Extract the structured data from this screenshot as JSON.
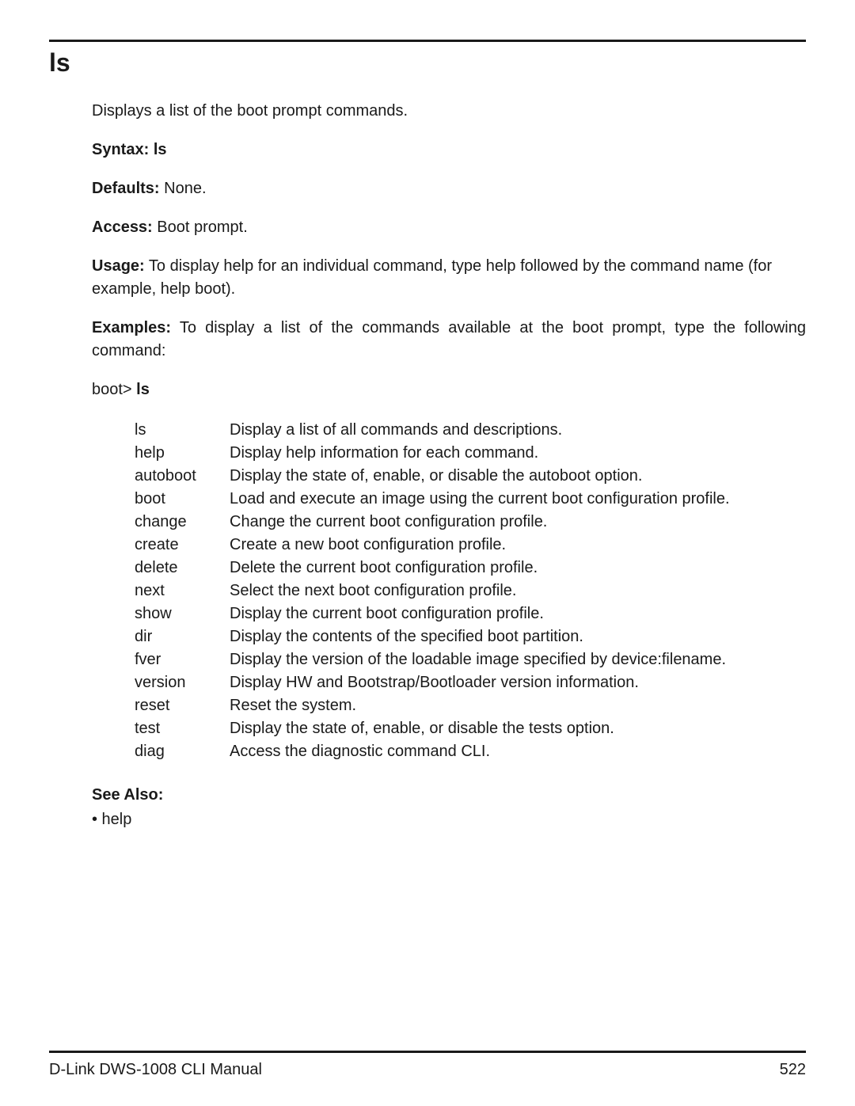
{
  "title": "ls",
  "intro": "Displays a list of the boot prompt commands.",
  "syntax_label": "Syntax:",
  "syntax_value": "ls",
  "defaults_label": "Defaults:",
  "defaults_value": "None.",
  "access_label": "Access:",
  "access_value": "Boot prompt.",
  "usage_label": "Usage:",
  "usage_value": "To display help for an individual command, type help followed by the command name (for example, help boot).",
  "examples_label": "Examples:",
  "examples_value": "To display a list of the commands available at the boot prompt, type the following command:",
  "prompt_prefix": "boot>",
  "prompt_cmd": "ls",
  "commands": [
    {
      "name": "ls",
      "desc": "Display a list of all commands and descriptions."
    },
    {
      "name": "help",
      "desc": "Display help information for each command."
    },
    {
      "name": "autoboot",
      "desc": "Display the state of, enable, or disable the autoboot option."
    },
    {
      "name": "boot",
      "desc": "Load and execute an image using the current boot configuration profile."
    },
    {
      "name": "change",
      "desc": "Change the current boot configuration profile."
    },
    {
      "name": "create",
      "desc": "Create a new boot configuration profile."
    },
    {
      "name": "delete",
      "desc": "Delete the current boot configuration profile."
    },
    {
      "name": "next",
      "desc": "Select the next boot configuration profile."
    },
    {
      "name": "show",
      "desc": "Display the current boot configuration profile."
    },
    {
      "name": "dir",
      "desc": "Display the contents of the specified boot partition."
    },
    {
      "name": "fver",
      "desc": "Display the version of the loadable image specified by device:filename."
    },
    {
      "name": "version",
      "desc": "Display HW and Bootstrap/Bootloader version information."
    },
    {
      "name": "reset",
      "desc": "Reset the system."
    },
    {
      "name": "test",
      "desc": "Display the state of, enable, or disable the tests option."
    },
    {
      "name": "diag",
      "desc": "Access the diagnostic command CLI."
    }
  ],
  "see_also_label": "See Also:",
  "see_also_item": "• help",
  "footer_left": "D-Link DWS-1008 CLI Manual",
  "footer_right": "522"
}
